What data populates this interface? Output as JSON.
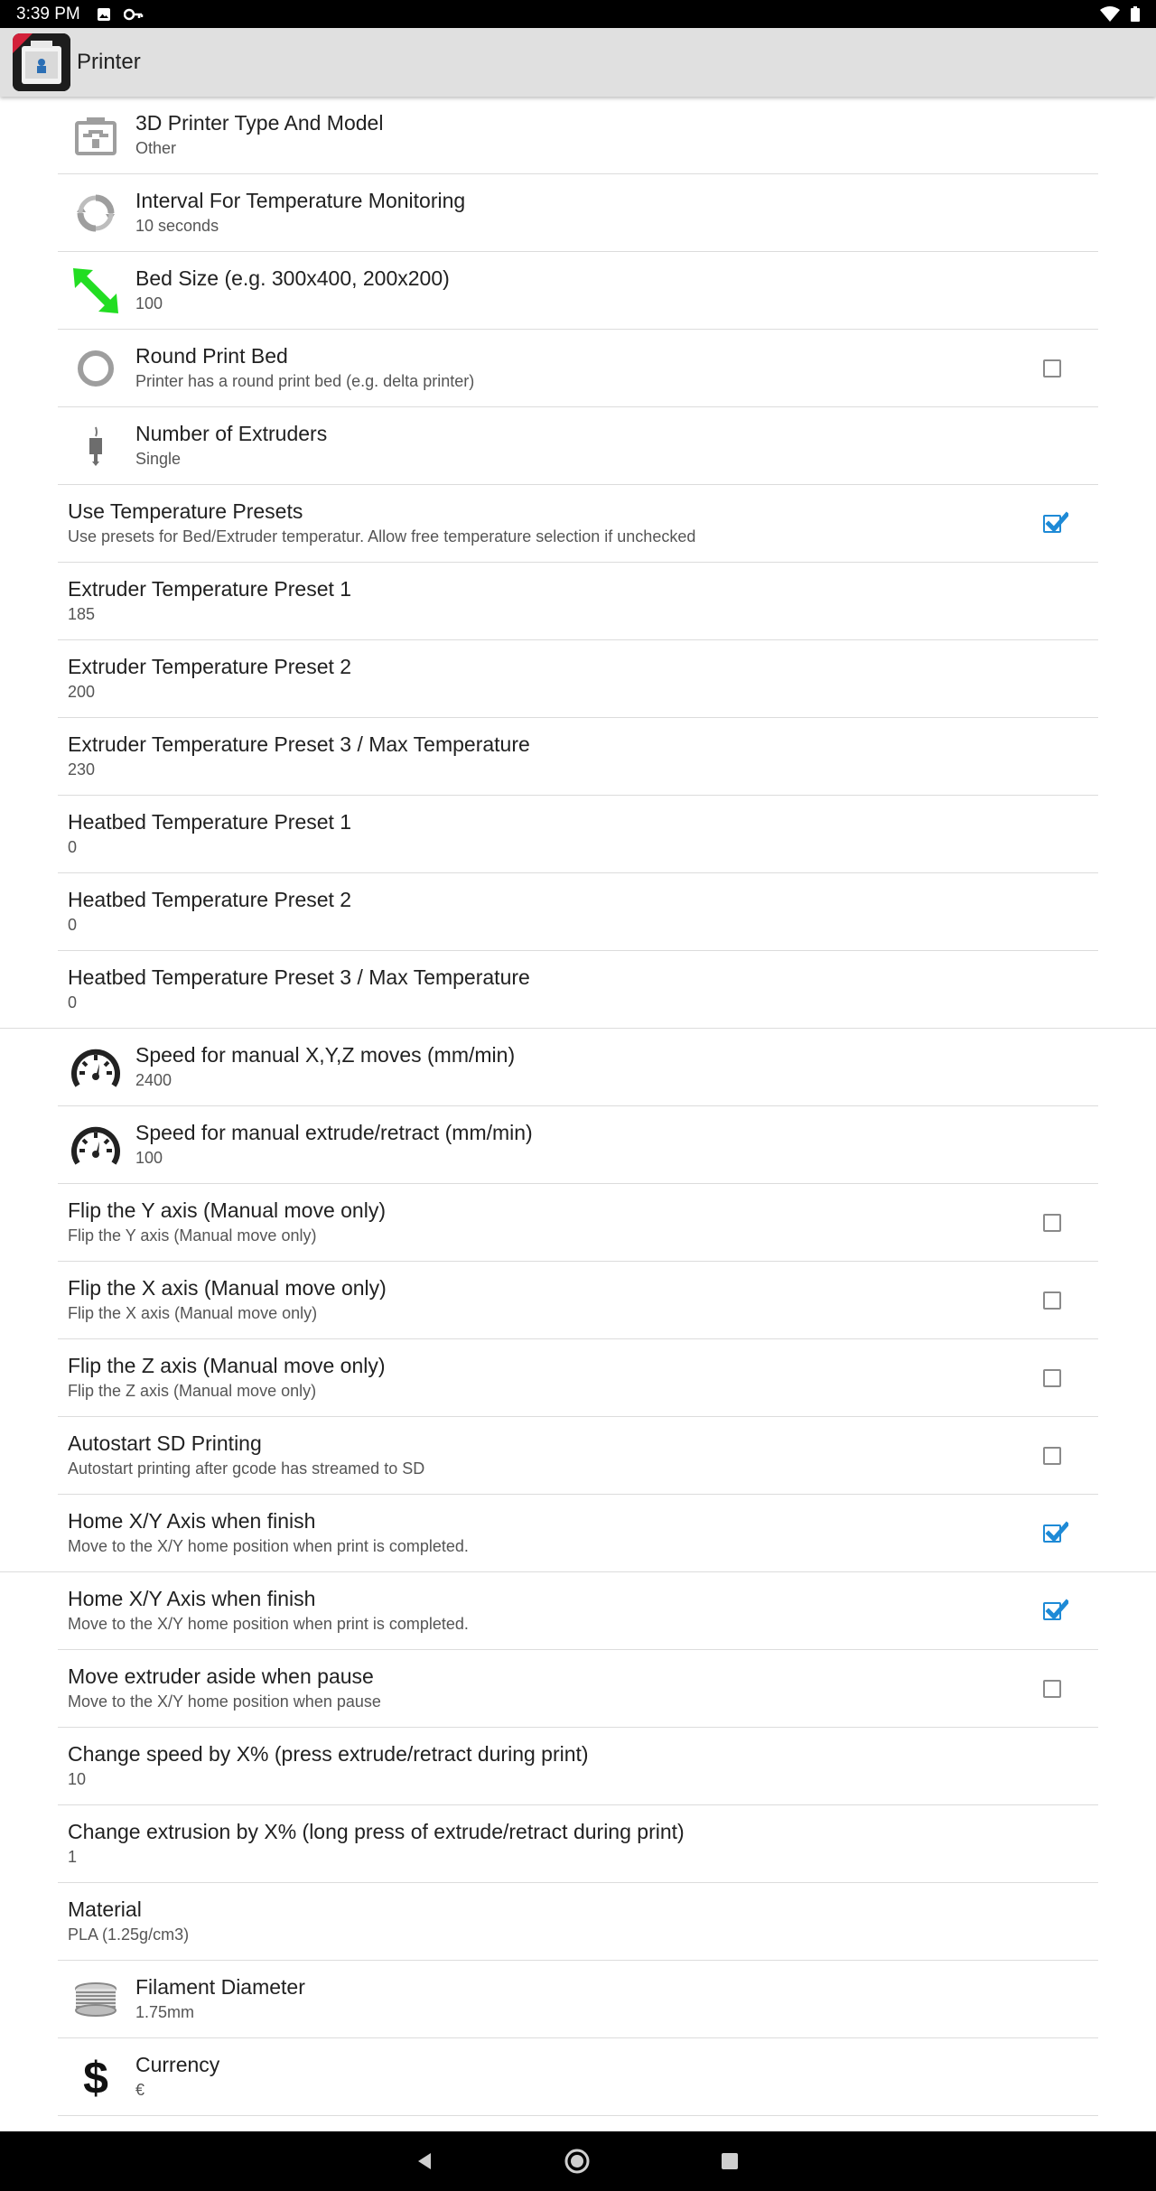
{
  "status_bar": {
    "time": "3:39 PM",
    "left_icons": [
      "image-icon",
      "key-icon"
    ],
    "right_icons": [
      "wifi-icon",
      "battery-icon"
    ]
  },
  "app_bar": {
    "title": "Printer",
    "logo_badge": "PRO"
  },
  "settings": [
    {
      "id": "printer-type",
      "icon": "printer-icon",
      "title": "3D Printer Type And Model",
      "summary": "Other",
      "control": "none"
    },
    {
      "id": "temp-interval",
      "icon": "refresh-icon",
      "title": "Interval For Temperature Monitoring",
      "summary": "10 seconds",
      "control": "none"
    },
    {
      "id": "bed-size",
      "icon": "resize-arrow-icon",
      "title": "Bed Size (e.g. 300x400, 200x200)",
      "summary": "100",
      "control": "none"
    },
    {
      "id": "round-bed",
      "icon": "ring-icon",
      "title": "Round Print Bed",
      "summary": "Printer has a round print bed (e.g. delta printer)",
      "control": "checkbox",
      "checked": false
    },
    {
      "id": "num-extruders",
      "icon": "extruder-icon",
      "title": "Number of Extruders",
      "summary": "Single",
      "control": "none"
    },
    {
      "id": "temp-presets",
      "icon": "",
      "title": "Use Temperature Presets",
      "summary": "Use presets for Bed/Extruder temperatur. Allow free temperature selection if unchecked",
      "control": "checkbox",
      "checked": true
    },
    {
      "id": "ext-preset-1",
      "icon": "",
      "title": "Extruder Temperature Preset 1",
      "summary": "185",
      "control": "none"
    },
    {
      "id": "ext-preset-2",
      "icon": "",
      "title": "Extruder Temperature Preset 2",
      "summary": "200",
      "control": "none"
    },
    {
      "id": "ext-preset-3",
      "icon": "",
      "title": "Extruder Temperature Preset 3 / Max Temperature",
      "summary": "230",
      "control": "none"
    },
    {
      "id": "bed-preset-1",
      "icon": "",
      "title": "Heatbed Temperature Preset 1",
      "summary": "0",
      "control": "none"
    },
    {
      "id": "bed-preset-2",
      "icon": "",
      "title": "Heatbed Temperature Preset 2",
      "summary": "0",
      "control": "none"
    },
    {
      "id": "bed-preset-3",
      "icon": "",
      "title": "Heatbed Temperature Preset 3 / Max Temperature",
      "summary": "0",
      "control": "none",
      "full_divider": true
    },
    {
      "id": "speed-xyz",
      "icon": "speedometer-icon",
      "title": "Speed for manual X,Y,Z moves (mm/min)",
      "summary": "2400",
      "control": "none"
    },
    {
      "id": "speed-extrude",
      "icon": "speedometer-icon",
      "title": "Speed for manual extrude/retract (mm/min)",
      "summary": "100",
      "control": "none"
    },
    {
      "id": "flip-y",
      "icon": "",
      "title": "Flip the Y axis (Manual move only)",
      "summary": "Flip the Y axis (Manual move only)",
      "control": "checkbox",
      "checked": false
    },
    {
      "id": "flip-x",
      "icon": "",
      "title": "Flip the X axis (Manual move only)",
      "summary": "Flip the X axis (Manual move only)",
      "control": "checkbox",
      "checked": false
    },
    {
      "id": "flip-z",
      "icon": "",
      "title": "Flip the Z axis (Manual move only)",
      "summary": "Flip the Z axis (Manual move only)",
      "control": "checkbox",
      "checked": false
    },
    {
      "id": "autostart-sd",
      "icon": "",
      "title": "Autostart SD Printing",
      "summary": "Autostart printing after gcode has streamed to SD",
      "control": "checkbox",
      "checked": false
    },
    {
      "id": "home-xy-1",
      "icon": "",
      "title": "Home X/Y Axis when finish",
      "summary": "Move to the X/Y home position when print is completed.",
      "control": "checkbox",
      "checked": true,
      "full_divider": true
    },
    {
      "id": "home-xy-2",
      "icon": "",
      "title": "Home X/Y Axis when finish",
      "summary": "Move to the X/Y home position when print is completed.",
      "control": "checkbox",
      "checked": true
    },
    {
      "id": "move-aside",
      "icon": "",
      "title": "Move extruder aside when pause",
      "summary": "Move to the X/Y home position when pause",
      "control": "checkbox",
      "checked": false
    },
    {
      "id": "change-speed",
      "icon": "",
      "title": "Change speed by X% (press extrude/retract during print)",
      "summary": "10",
      "control": "none"
    },
    {
      "id": "change-extrusion",
      "icon": "",
      "title": "Change extrusion by X% (long press of extrude/retract during print)",
      "summary": "1",
      "control": "none"
    },
    {
      "id": "material",
      "icon": "",
      "title": "Material",
      "summary": "PLA (1.25g/cm3)",
      "control": "none"
    },
    {
      "id": "filament-diameter",
      "icon": "filament-spool-icon",
      "title": "Filament Diameter",
      "summary": "1.75mm",
      "control": "none"
    },
    {
      "id": "currency",
      "icon": "dollar-icon",
      "title": "Currency",
      "summary": "€",
      "control": "none"
    }
  ],
  "nav_bar": {
    "buttons": [
      "back-icon",
      "home-icon",
      "recents-icon"
    ]
  },
  "colors": {
    "accent": "#1e8ad6",
    "bed_size_icon": "#22dd22",
    "app_bar": "#e0e0e0"
  }
}
